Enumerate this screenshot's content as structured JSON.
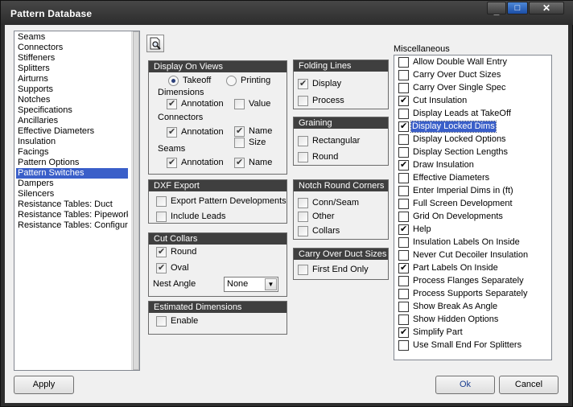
{
  "window": {
    "title": "Pattern Database"
  },
  "sidebar": {
    "items": [
      {
        "label": "Seams"
      },
      {
        "label": "Connectors"
      },
      {
        "label": "Stiffeners"
      },
      {
        "label": "Splitters"
      },
      {
        "label": "Airturns"
      },
      {
        "label": "Supports"
      },
      {
        "label": "Notches"
      },
      {
        "label": "Specifications"
      },
      {
        "label": "Ancillaries"
      },
      {
        "label": "Effective Diameters"
      },
      {
        "label": "Insulation"
      },
      {
        "label": "Facings"
      },
      {
        "label": "Pattern Options"
      },
      {
        "label": "Pattern Switches",
        "selected": true
      },
      {
        "label": "Dampers"
      },
      {
        "label": "Silencers"
      },
      {
        "label": "Resistance Tables: Duct"
      },
      {
        "label": "Resistance Tables: Pipework"
      },
      {
        "label": "Resistance Tables: Configura"
      }
    ]
  },
  "toolbar": {
    "preview_icon": "page-search-icon"
  },
  "display_on_views": {
    "title": "Display On Views",
    "takeoff": "Takeoff",
    "printing": "Printing",
    "selected": "Takeoff",
    "dimensions": "Dimensions",
    "dim_annotation": "Annotation",
    "dim_annotation_checked": true,
    "dim_value": "Value",
    "dim_value_checked": false,
    "connectors": "Connectors",
    "con_annotation": "Annotation",
    "con_annotation_checked": true,
    "con_name": "Name",
    "con_name_checked": true,
    "con_size": "Size",
    "con_size_checked": false,
    "seams": "Seams",
    "seam_annotation": "Annotation",
    "seam_annotation_checked": true,
    "seam_name": "Name",
    "seam_name_checked": true
  },
  "dxf_export": {
    "title": "DXF Export",
    "export_pattern": "Export Pattern Developments",
    "export_pattern_checked": false,
    "include_leads": "Include Leads",
    "include_leads_checked": false
  },
  "cut_collars": {
    "title": "Cut Collars",
    "round": "Round",
    "round_checked": true,
    "oval": "Oval",
    "oval_checked": true,
    "nest_angle_label": "Nest Angle",
    "nest_angle_value": "None"
  },
  "estimated_dimensions": {
    "title": "Estimated Dimensions",
    "enable": "Enable",
    "enable_checked": false
  },
  "folding_lines": {
    "title": "Folding Lines",
    "display": "Display",
    "display_checked": true,
    "process": "Process",
    "process_checked": false
  },
  "graining": {
    "title": "Graining",
    "rectangular": "Rectangular",
    "rectangular_checked": false,
    "round": "Round",
    "round_checked": false
  },
  "notch_round_corners": {
    "title": "Notch Round Corners",
    "conn_seam": "Conn/Seam",
    "conn_seam_checked": false,
    "other": "Other",
    "other_checked": false,
    "collars": "Collars",
    "collars_checked": false
  },
  "carry_over_duct_sizes": {
    "title": "Carry Over Duct Sizes",
    "first_end_only": "First End Only",
    "first_end_only_checked": false
  },
  "miscellaneous": {
    "title": "Miscellaneous",
    "items": [
      {
        "label": "Allow Double Wall Entry",
        "checked": false
      },
      {
        "label": "Carry Over Duct Sizes",
        "checked": false
      },
      {
        "label": "Carry Over Single Spec",
        "checked": false
      },
      {
        "label": "Cut Insulation",
        "checked": true
      },
      {
        "label": "Display Leads at TakeOff",
        "checked": false
      },
      {
        "label": "Display Locked Dims",
        "checked": true,
        "highlighted": true
      },
      {
        "label": "Display Locked Options",
        "checked": false
      },
      {
        "label": "Display Section Lengths",
        "checked": false
      },
      {
        "label": "Draw Insulation",
        "checked": true
      },
      {
        "label": "Effective Diameters",
        "checked": false
      },
      {
        "label": "Enter Imperial Dims in (ft)",
        "checked": false
      },
      {
        "label": "Full Screen Development",
        "checked": false
      },
      {
        "label": "Grid On Developments",
        "checked": false
      },
      {
        "label": "Help",
        "checked": true
      },
      {
        "label": "Insulation Labels On Inside",
        "checked": false
      },
      {
        "label": "Never Cut Decoiler Insulation",
        "checked": false
      },
      {
        "label": "Part Labels On Inside",
        "checked": true
      },
      {
        "label": "Process Flanges Separately",
        "checked": false
      },
      {
        "label": "Process Supports Separately",
        "checked": false
      },
      {
        "label": "Show Break As Angle",
        "checked": false
      },
      {
        "label": "Show Hidden Options",
        "checked": false
      },
      {
        "label": "Simplify Part",
        "checked": true
      },
      {
        "label": "Use Small End For Splitters",
        "checked": false
      }
    ]
  },
  "buttons": {
    "apply": "Apply",
    "ok": "Ok",
    "cancel": "Cancel"
  }
}
